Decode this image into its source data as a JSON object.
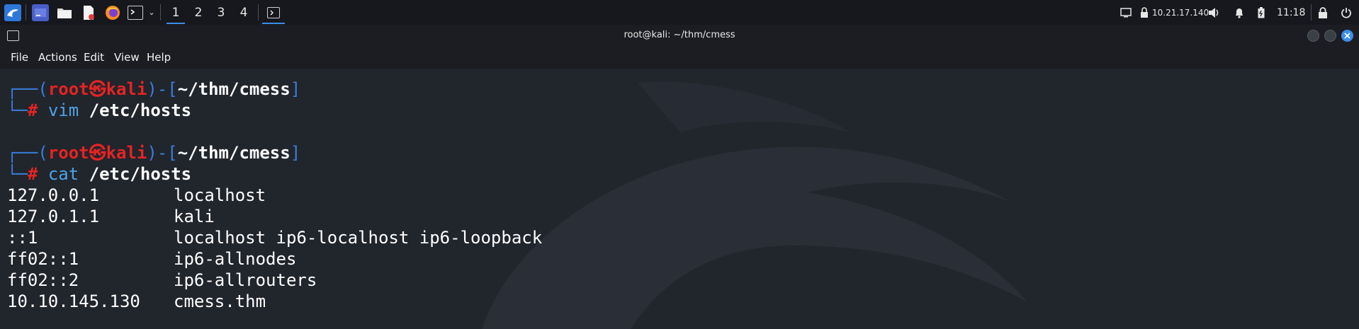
{
  "taskbar": {
    "workspaces": [
      "1",
      "2",
      "3",
      "4"
    ],
    "ip": "10.21.17.140",
    "clock": "11:18",
    "icons": [
      "kali-menu-icon",
      "show-desktop-icon",
      "file-manager-icon",
      "text-editor-icon",
      "firefox-icon",
      "terminal-icon",
      "chevron-down-icon",
      "terminal-task-icon",
      "monitor-icon",
      "vpn-lock-icon",
      "volume-icon",
      "notification-bell-icon",
      "battery-icon",
      "lock-icon",
      "power-icon"
    ]
  },
  "window": {
    "title": "root@kali: ~/thm/cmess"
  },
  "menubar": {
    "items": [
      "File",
      "Actions",
      "Edit",
      "View",
      "Help"
    ]
  },
  "terminal": {
    "prompts": [
      {
        "user": "root",
        "host": "kali",
        "path": "~/thm/cmess",
        "cmd": "vim",
        "arg": "/etc/hosts"
      },
      {
        "user": "root",
        "host": "kali",
        "path": "~/thm/cmess",
        "cmd": "cat",
        "arg": "/etc/hosts"
      }
    ],
    "hosts": [
      {
        "ip": "127.0.0.1",
        "names": "localhost"
      },
      {
        "ip": "127.0.1.1",
        "names": "kali"
      },
      {
        "ip": "::1",
        "names": "localhost ip6-localhost ip6-loopback"
      },
      {
        "ip": "ff02::1",
        "names": "ip6-allnodes"
      },
      {
        "ip": "ff02::2",
        "names": "ip6-allrouters"
      },
      {
        "ip": "10.10.145.130",
        "names": "cmess.thm"
      }
    ]
  },
  "colors": {
    "prompt_frame": "#3a7ddb",
    "prompt_user": "#e52424",
    "command": "#4ea3e8",
    "accent": "#3b8ee8"
  }
}
